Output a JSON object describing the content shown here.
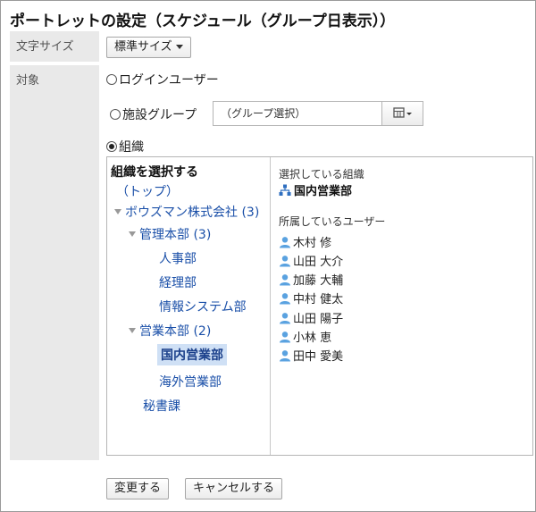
{
  "page": {
    "title": "ポートレットの設定（スケジュール（グループ日表示））"
  },
  "font_size": {
    "label": "文字サイズ",
    "selected": "標準サイズ"
  },
  "target": {
    "label": "対象",
    "options": {
      "login_user": "ログインユーザー",
      "facility_group": "施設グループ",
      "organization": "組織"
    },
    "selected": "organization",
    "group_select_placeholder": "（グループ選択）"
  },
  "org_tree": {
    "heading": "組織を選択する",
    "nodes": [
      {
        "label": "（トップ）",
        "level": 0,
        "toggle": false,
        "selected": false
      },
      {
        "label": "ボウズマン株式会社 (3)",
        "level": 0,
        "toggle": true,
        "selected": false
      },
      {
        "label": "管理本部 (3)",
        "level": 1,
        "toggle": true,
        "selected": false
      },
      {
        "label": "人事部",
        "level": 2,
        "toggle": false,
        "selected": false
      },
      {
        "label": "経理部",
        "level": 2,
        "toggle": false,
        "selected": false
      },
      {
        "label": "情報システム部",
        "level": 2,
        "toggle": false,
        "selected": false
      },
      {
        "label": "営業本部 (2)",
        "level": 1,
        "toggle": true,
        "selected": false
      },
      {
        "label": "国内営業部",
        "level": 2,
        "toggle": false,
        "selected": true
      },
      {
        "label": "海外営業部",
        "level": 2,
        "toggle": false,
        "selected": false
      },
      {
        "label": "秘書課",
        "level": 1,
        "toggle": false,
        "selected": false
      }
    ]
  },
  "selected_org": {
    "label": "選択している組織",
    "name": "国内営業部"
  },
  "members": {
    "label": "所属しているユーザー",
    "users": [
      "木村 修",
      "山田 大介",
      "加藤 大輔",
      "中村 健太",
      "山田 陽子",
      "小林 恵",
      "田中 愛美"
    ]
  },
  "actions": {
    "submit": "変更する",
    "cancel": "キャンセルする"
  },
  "colors": {
    "accent_link": "#1a4fa8",
    "selected_bg": "#cfe0f5",
    "label_bg": "#e9e9e9"
  }
}
